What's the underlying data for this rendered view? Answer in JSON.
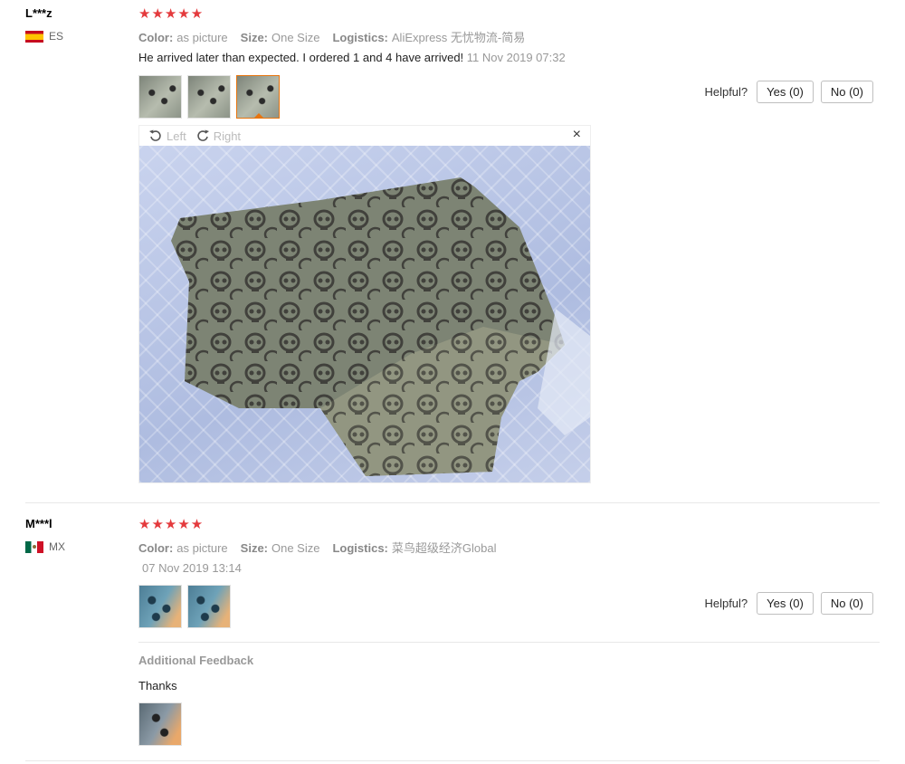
{
  "reviews": [
    {
      "user": "L***z",
      "country": "ES",
      "stars": "★★★★★",
      "attrs": {
        "color_label": "Color:",
        "color_value": "as picture",
        "size_label": "Size:",
        "size_value": "One Size",
        "logistics_label": "Logistics:",
        "logistics_value": "AliExpress 无忧物流-简易"
      },
      "text": "He arrived later than expected. I ordered 1 and 4 have arrived!",
      "date": "11 Nov 2019 07:32",
      "helpful": {
        "label": "Helpful?",
        "yes": "Yes (0)",
        "no": "No (0)"
      },
      "viewer": {
        "left": "Left",
        "right": "Right",
        "close": "×"
      }
    },
    {
      "user": "M***l",
      "country": "MX",
      "stars": "★★★★★",
      "attrs": {
        "color_label": "Color:",
        "color_value": "as picture",
        "size_label": "Size:",
        "size_value": "One Size",
        "logistics_label": "Logistics:",
        "logistics_value": "菜鸟超级经济Global"
      },
      "date": "07 Nov 2019 13:14",
      "helpful": {
        "label": "Helpful?",
        "yes": "Yes (0)",
        "no": "No (0)"
      },
      "additional_feedback": {
        "title": "Additional Feedback",
        "text": "Thanks"
      }
    }
  ]
}
